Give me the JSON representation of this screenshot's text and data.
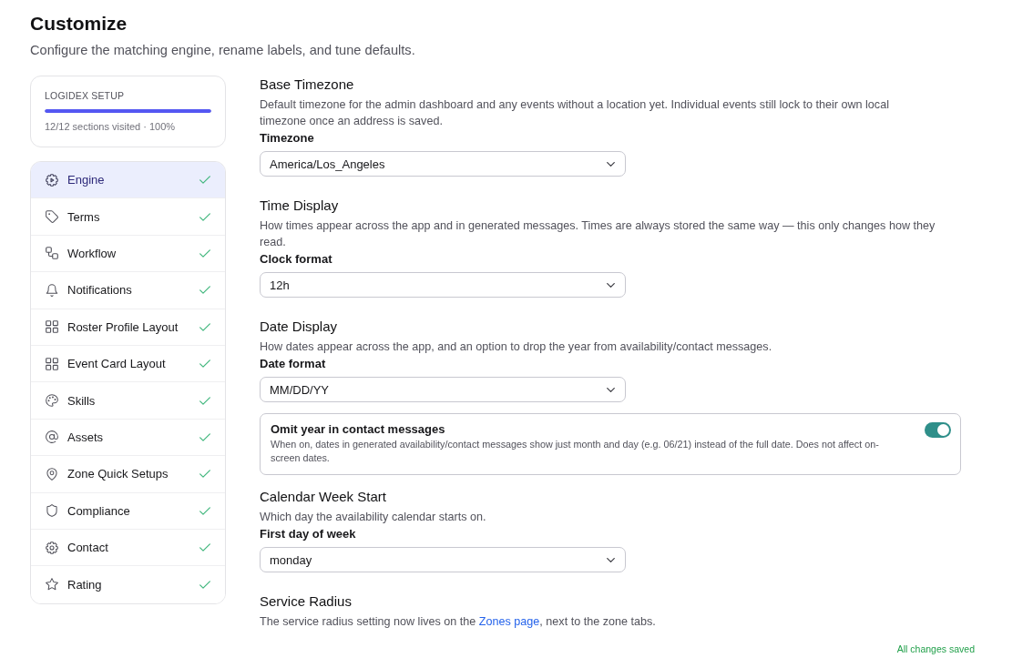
{
  "page": {
    "title": "Customize",
    "subtitle": "Configure the matching engine, rename labels, and tune defaults."
  },
  "setup": {
    "title": "LOGIDEX SETUP",
    "level": 1.0,
    "summary": "12/12 sections visited · 100%"
  },
  "sidebar": {
    "items": [
      {
        "label": "Engine",
        "selected": true,
        "visited": true
      },
      {
        "label": "Terms",
        "selected": false,
        "visited": true
      },
      {
        "label": "Workflow",
        "selected": false,
        "visited": true
      },
      {
        "label": "Notifications",
        "selected": false,
        "visited": true
      },
      {
        "label": "Roster Profile Layout",
        "selected": false,
        "visited": true
      },
      {
        "label": "Event Card Layout",
        "selected": false,
        "visited": true
      },
      {
        "label": "Skills",
        "selected": false,
        "visited": true
      },
      {
        "label": "Assets",
        "selected": false,
        "visited": true
      },
      {
        "label": "Zone Quick Setups",
        "selected": false,
        "visited": true
      },
      {
        "label": "Compliance",
        "selected": false,
        "visited": true
      },
      {
        "label": "Contact",
        "selected": false,
        "visited": true
      },
      {
        "label": "Rating",
        "selected": false,
        "visited": true
      }
    ]
  },
  "sections": [
    {
      "title": "Base Timezone",
      "description": "Default timezone for the admin dashboard and any events without a location yet. Individual events still lock to their own local timezone once an address is saved.",
      "fields": [
        {
          "kind": "select",
          "label": "Timezone",
          "value": "America/Los_Angeles"
        }
      ]
    },
    {
      "title": "Time Display",
      "description": "How times appear across the app and in generated messages. Times are always stored the same way — this only changes how they read.",
      "fields": [
        {
          "kind": "select",
          "label": "Clock format",
          "value": "12h"
        }
      ]
    },
    {
      "title": "Date Display",
      "description": "How dates appear across the app, and an option to drop the year from availability/contact messages.",
      "fields": [
        {
          "kind": "select",
          "label": "Date format",
          "value": "MM/DD/YY"
        },
        {
          "kind": "toggle",
          "label": "Omit year in contact messages",
          "description": "When on, dates in generated availability/contact messages show just month and day (e.g. 06/21) instead of the full date. Does not affect on-screen dates.",
          "on": true
        }
      ]
    },
    {
      "title": "Calendar Week Start",
      "description": "Which day the availability calendar starts on.",
      "fields": [
        {
          "kind": "select",
          "label": "First day of week",
          "value": "monday"
        }
      ]
    },
    {
      "title": "Service Radius",
      "description": [
        {
          "kind": "text",
          "text": "The service radius setting now lives on the "
        },
        {
          "kind": "link",
          "text": "Zones page"
        },
        {
          "kind": "text",
          "text": ", next to the zone tabs."
        }
      ]
    }
  ],
  "status": "All changes saved"
}
